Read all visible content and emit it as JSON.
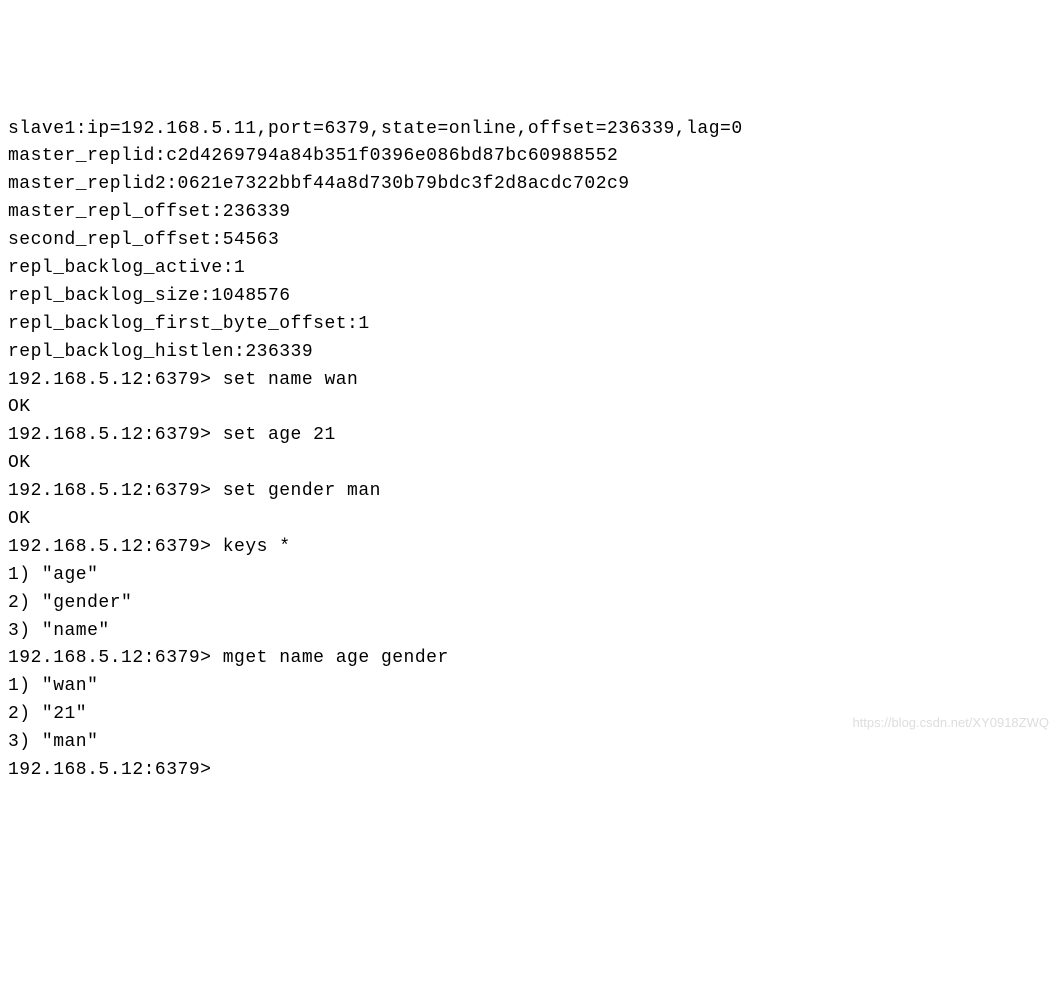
{
  "terminal": {
    "lines": [
      "slave1:ip=192.168.5.11,port=6379,state=online,offset=236339,lag=0",
      "master_replid:c2d4269794a84b351f0396e086bd87bc60988552",
      "master_replid2:0621e7322bbf44a8d730b79bdc3f2d8acdc702c9",
      "master_repl_offset:236339",
      "second_repl_offset:54563",
      "repl_backlog_active:1",
      "repl_backlog_size:1048576",
      "repl_backlog_first_byte_offset:1",
      "repl_backlog_histlen:236339",
      "192.168.5.12:6379> set name wan",
      "OK",
      "192.168.5.12:6379> set age 21",
      "OK",
      "192.168.5.12:6379> set gender man",
      "OK",
      "192.168.5.12:6379> keys *",
      "1) \"age\"",
      "2) \"gender\"",
      "3) \"name\"",
      "192.168.5.12:6379> mget name age gender",
      "1) \"wan\"",
      "2) \"21\"",
      "3) \"man\"",
      "192.168.5.12:6379>"
    ]
  },
  "watermark": "https://blog.csdn.net/XY0918ZWQ"
}
